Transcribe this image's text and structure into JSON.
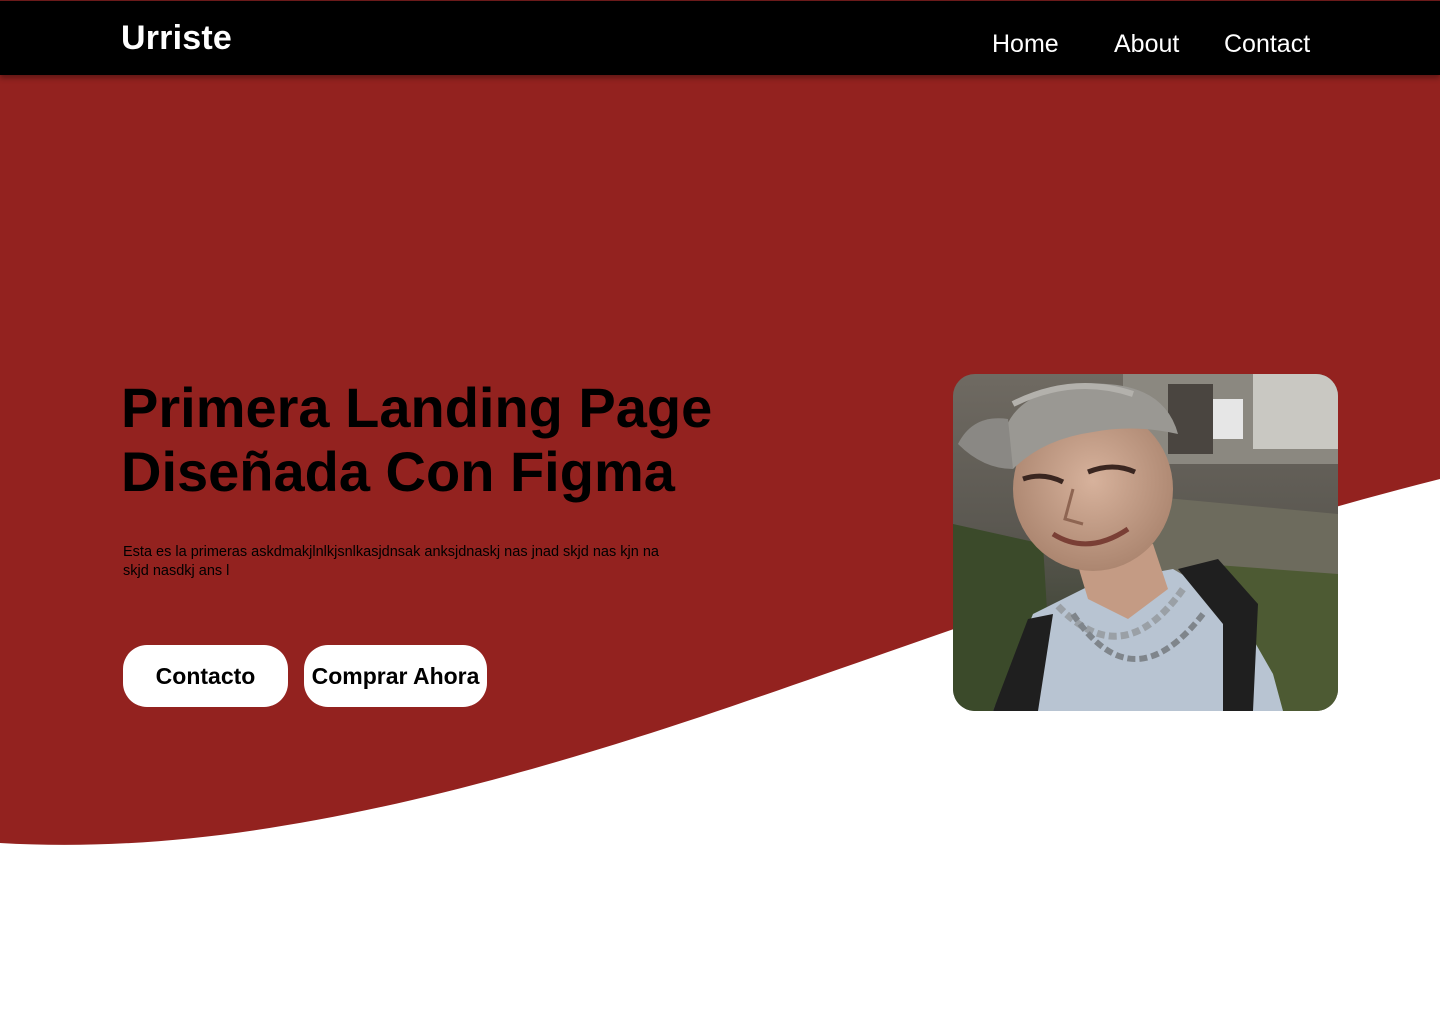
{
  "navbar": {
    "logo": "Urriste",
    "links": [
      "Home",
      "About",
      "Contact"
    ]
  },
  "hero": {
    "title_line1": "Primera Landing Page",
    "title_line2": "Diseñada Con Figma",
    "description": "Esta es la primeras askdmakjlnlkjsnlkasjdnsak  anksjdnaskj nas jnad skjd nas kjn na skjd nasdkj ans l",
    "buttons": [
      "Contacto",
      "Comprar Ahora"
    ],
    "image_icon": "person-photo-icon"
  },
  "colors": {
    "hero_background": "#93221f",
    "navbar_background": "#000000",
    "button_background": "#ffffff",
    "text_dark": "#000000",
    "text_light": "#ffffff"
  }
}
